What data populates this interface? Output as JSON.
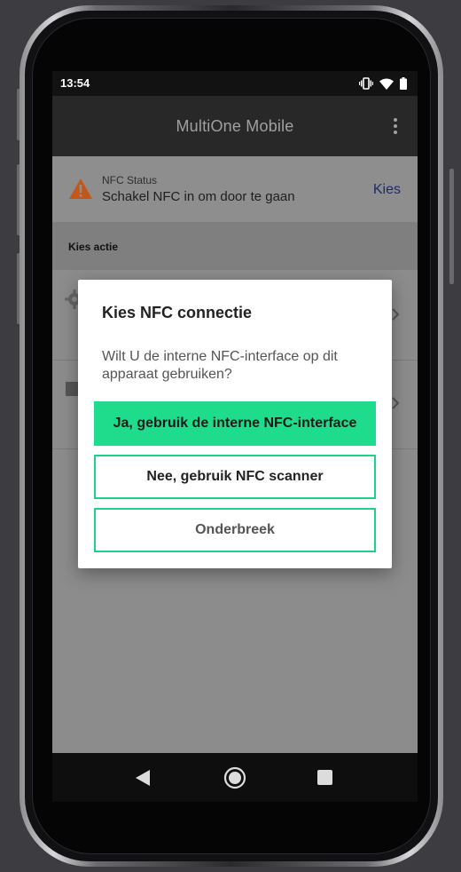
{
  "status_bar": {
    "time": "13:54",
    "icons": [
      "vibrate-icon",
      "wifi-icon",
      "battery-icon"
    ]
  },
  "app_bar": {
    "title": "MultiOne Mobile",
    "menu_icon": "more-vert-icon"
  },
  "nfc_status": {
    "label": "NFC Status",
    "message": "Schakel NFC in om door te gaan",
    "action_label": "Kies",
    "icon": "warning-icon"
  },
  "section": {
    "header": "Kies actie"
  },
  "list": {
    "items": [
      {
        "icon": "gear-icon"
      },
      {
        "icon": "folder-icon"
      }
    ]
  },
  "dialog": {
    "title": "Kies NFC connectie",
    "message": "Wilt U de interne NFC-interface op dit apparaat gebruiken?",
    "primary_button": "Ja, gebruik de interne NFC-interface",
    "secondary_button": "Nee, gebruik NFC scanner",
    "cancel_button": "Onderbreek"
  },
  "nav_bar": {
    "icons": [
      "back-icon",
      "home-icon",
      "recents-icon"
    ]
  },
  "colors": {
    "accent": "#1fdc8c",
    "warning": "#c4561a",
    "link": "#1e2a6b"
  }
}
